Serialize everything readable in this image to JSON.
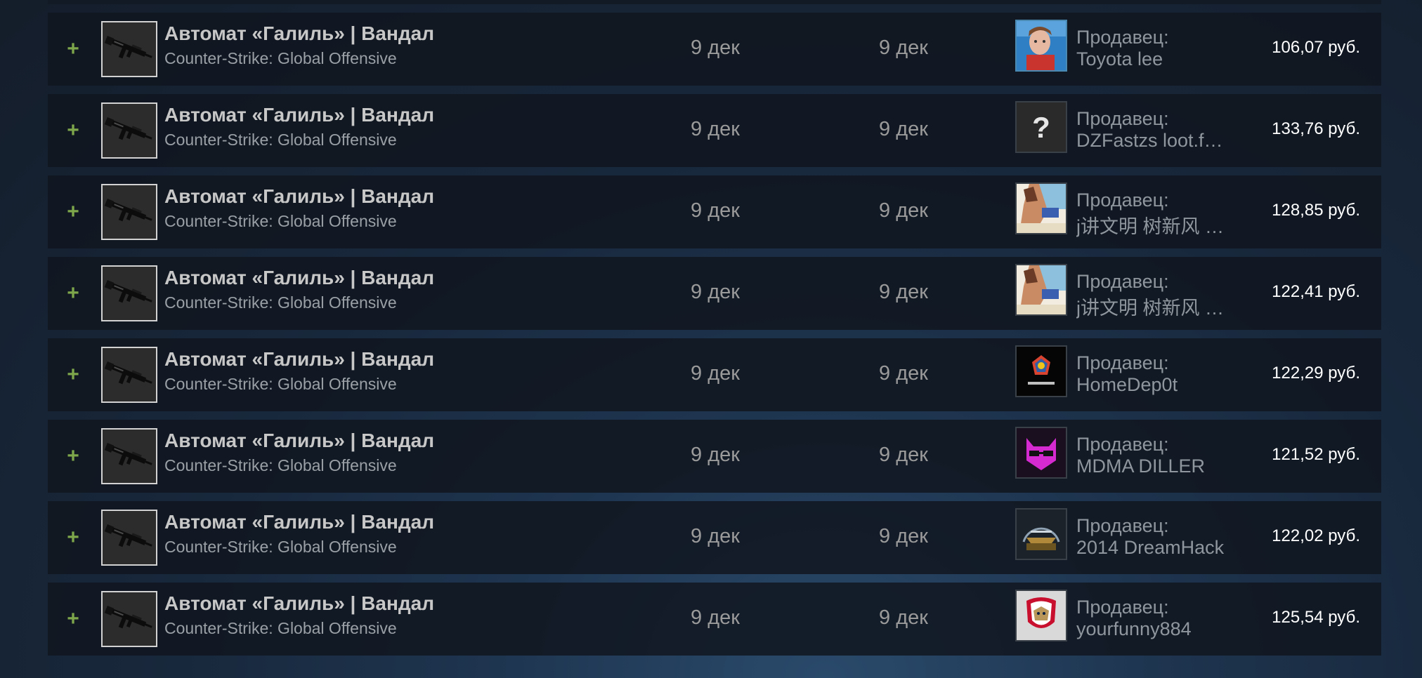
{
  "listings": [
    {
      "item_name": "Автомат «Галиль» | Вандал",
      "game": "Counter-Strike: Global Offensive",
      "date_listed": "9 дек",
      "date_acted": "9 дек",
      "seller_label": "Продавец:",
      "seller_name": "Toyota lee",
      "avatar": "photo-avatar",
      "price": "106,07 руб."
    },
    {
      "item_name": "Автомат «Галиль» | Вандал",
      "game": "Counter-Strike: Global Offensive",
      "date_listed": "9 дек",
      "date_acted": "9 дек",
      "seller_label": "Продавец:",
      "seller_name": "DZFastzs loot.f…",
      "avatar": "question-mark-avatar",
      "price": "133,76 руб."
    },
    {
      "item_name": "Автомат «Галиль» | Вандал",
      "game": "Counter-Strike: Global Offensive",
      "date_listed": "9 дек",
      "date_acted": "9 дек",
      "seller_label": "Продавец:",
      "seller_name": "j讲文明 树新风 …",
      "avatar": "anime-avatar",
      "price": "128,85 руб."
    },
    {
      "item_name": "Автомат «Галиль» | Вандал",
      "game": "Counter-Strike: Global Offensive",
      "date_listed": "9 дек",
      "date_acted": "9 дек",
      "seller_label": "Продавец:",
      "seller_name": "j讲文明 树新风 …",
      "avatar": "anime-avatar",
      "price": "122,41 руб."
    },
    {
      "item_name": "Автомат «Галиль» | Вандал",
      "game": "Counter-Strike: Global Offensive",
      "date_listed": "9 дек",
      "date_acted": "9 дек",
      "seller_label": "Продавец:",
      "seller_name": "HomeDep0t",
      "avatar": "emblem-avatar",
      "price": "122,29 руб."
    },
    {
      "item_name": "Автомат «Галиль» | Вандал",
      "game": "Counter-Strike: Global Offensive",
      "date_listed": "9 дек",
      "date_acted": "9 дек",
      "seller_label": "Продавец:",
      "seller_name": "MDMA DILLER",
      "avatar": "neon-cat-avatar",
      "price": "121,52 руб."
    },
    {
      "item_name": "Автомат «Галиль» | Вандал",
      "game": "Counter-Strike: Global Offensive",
      "date_listed": "9 дек",
      "date_acted": "9 дек",
      "seller_label": "Продавец:",
      "seller_name": "2014 DreamHack",
      "avatar": "dreamhack-avatar",
      "price": "122,02 руб."
    },
    {
      "item_name": "Автомат «Галиль» | Вандал",
      "game": "Counter-Strike: Global Offensive",
      "date_listed": "9 дек",
      "date_acted": "9 дек",
      "seller_label": "Продавец:",
      "seller_name": "yourfunny884",
      "avatar": "panthers-logo-avatar",
      "price": "125,54 руб."
    }
  ],
  "colors": {
    "plus": "#7ea64b",
    "row_bg": "#10161f",
    "price": "#ffffff",
    "muted_text": "#8f969d"
  },
  "icons": {
    "expand": "plus-icon",
    "item": "rifle-icon"
  }
}
